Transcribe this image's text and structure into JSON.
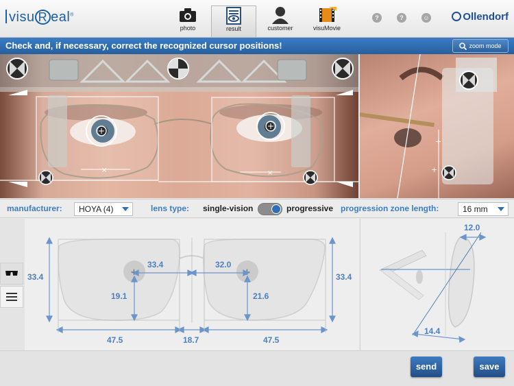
{
  "app": {
    "logo_text": "visuReal",
    "brand": "Ollendorf"
  },
  "nav": {
    "tabs": [
      {
        "label": "photo",
        "icon": "camera-icon"
      },
      {
        "label": "result",
        "icon": "result-icon"
      },
      {
        "label": "customer",
        "icon": "person-icon"
      },
      {
        "label": "visuMovie",
        "icon": "film-icon"
      }
    ],
    "active": "result",
    "help_icons": [
      "?",
      "?",
      "☺"
    ]
  },
  "instruction": {
    "text": "Check and, if necessary, correct the recognized cursor positions!",
    "zoom_button": "zoom mode"
  },
  "settings": {
    "manufacturer_label": "manufacturer:",
    "manufacturer_value": "HOYA (4)",
    "lens_type_label": "lens type:",
    "lens_option_left": "single-vision",
    "lens_option_right": "progressive",
    "lens_toggle_state": "progressive",
    "progression_label": "progression zone length:",
    "progression_value": "16 mm"
  },
  "measurements": {
    "box_height_left": "33.4",
    "box_height_right": "33.4",
    "pd_left": "33.4",
    "pd_right": "32.0",
    "fitting_height_left": "19.1",
    "fitting_height_right": "21.6",
    "box_width_left": "47.5",
    "bridge": "18.7",
    "box_width_right": "47.5",
    "vertex_distance": "12.0",
    "pantoscopic_tilt": "14.4"
  },
  "actions": {
    "send": "send",
    "save": "save"
  },
  "colors": {
    "accent": "#2f6fb5",
    "dimension": "#4b7fc0",
    "header": "#2e6fb8"
  }
}
